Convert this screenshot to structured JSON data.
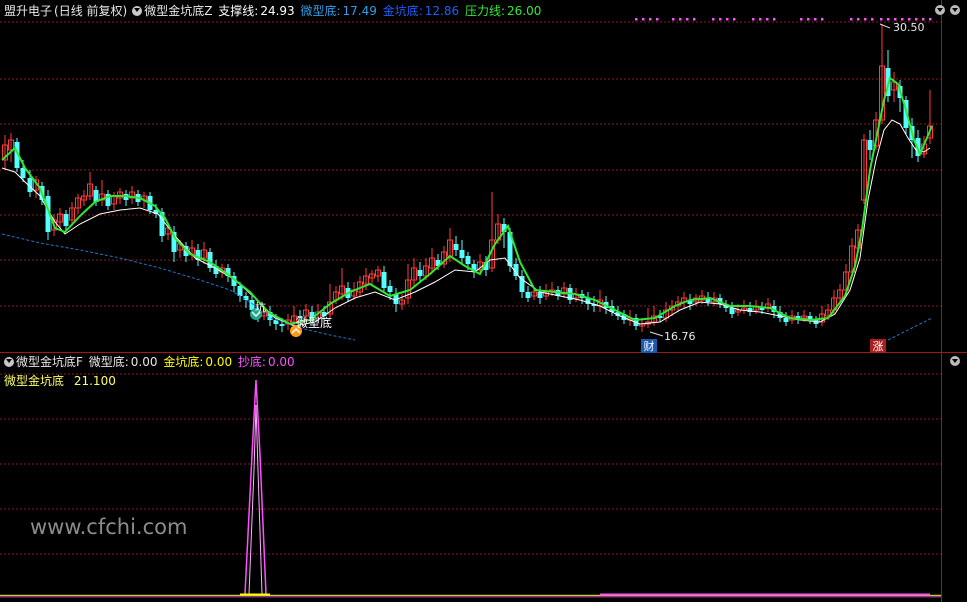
{
  "top_header": {
    "title": "盟升电子",
    "period": "(日线 前复权)",
    "indicator": "微型金坑底Z",
    "support_label": "支撑线:",
    "support_value": "24.93",
    "micro_label": "微型底:",
    "micro_value": "17.49",
    "pit_label": "金坑底:",
    "pit_value": "12.86",
    "pressure_label": "压力线:",
    "pressure_value": "26.00"
  },
  "bottom_header": {
    "indicator": "微型金坑底F",
    "micro_label": "微型底:",
    "micro_value": "0.00",
    "pit_label": "金坑底:",
    "pit_value": "0.00",
    "chaodi_label": "抄底:",
    "chaodi_value": "0.00",
    "formula_name": "微型金坑底",
    "formula_value": "21.100"
  },
  "annotations": {
    "high": "30.50",
    "low": "16.76",
    "micro_bottom_mark": "微型底",
    "pit_bottom_mark": "坑",
    "cai_badge": "财",
    "zhang_badge": "涨"
  },
  "watermark": "www.cfchi.com",
  "colors": {
    "up": "#ff3c3c",
    "down": "#54ffff",
    "ma": "#2ee82e",
    "white_line": "#ffffff",
    "support_dash": "#1e78c8",
    "grid": "#8a1a1a",
    "border": "#a01616",
    "pink": "#ff50ff",
    "yellow": "#ffff00"
  },
  "chart_data": {
    "type": "candlestick",
    "y_ticks": [],
    "price_low": 16.76,
    "price_high": 30.5,
    "micro_bottom_signal_strength": 21.1
  }
}
